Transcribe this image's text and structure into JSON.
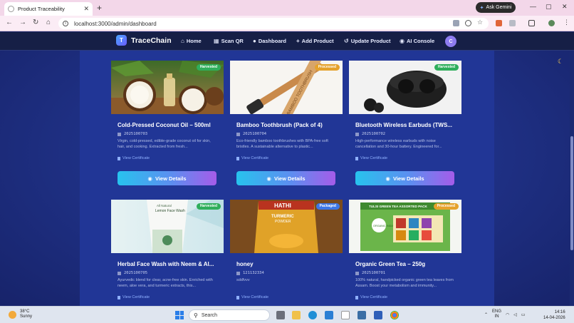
{
  "browser": {
    "tab_title": "Product Traceability",
    "tab_close": "✕",
    "new_tab": "+",
    "url": "localhost:3000/admin/dashboard",
    "ask_gemini": "Ask Gemini",
    "window_controls": [
      "—",
      "▢",
      "✕"
    ],
    "nav_icons": [
      "back-icon",
      "forward-icon",
      "reload-icon",
      "home-icon"
    ]
  },
  "app": {
    "logo_letter": "T",
    "brand": "TraceChain",
    "nav": [
      {
        "label": "Home",
        "icon": "home-icon",
        "glyph": "⌂"
      },
      {
        "label": "Scan QR",
        "icon": "qr-icon",
        "glyph": "▦"
      },
      {
        "label": "Dashboard",
        "icon": "user-icon",
        "glyph": "●"
      },
      {
        "label": "Add Product",
        "icon": "plus-icon",
        "glyph": "+"
      },
      {
        "label": "Update Product",
        "icon": "history-icon",
        "glyph": "↺"
      },
      {
        "label": "AI Console",
        "icon": "robot-icon",
        "glyph": "◉"
      }
    ],
    "avatar_letter": "C"
  },
  "products": [
    {
      "title": "Cold-Pressed Coconut Oil – 500ml",
      "id": "2025100703",
      "status": "Harvested",
      "status_type": "harvested",
      "desc": "Virgin, cold-pressed, edible-grade coconut oil for skin, hair, and cooking. Extracted from fresh...",
      "cert": "View Certificate",
      "button": "View Details"
    },
    {
      "title": "Bamboo Toothbrush (Pack of 4)",
      "id": "2025100704",
      "status": "Processed",
      "status_type": "processed",
      "desc": "Eco-friendly bamboo toothbrushes with BPA-free soft bristles. A sustainable alternative to plastic...",
      "cert": "View Certificate",
      "button": "View Details"
    },
    {
      "title": "Bluetooth Wireless Earbuds (TWS...",
      "id": "2025100702",
      "status": "Harvested",
      "status_type": "harvested",
      "desc": "High-performance wireless earbuds with noise cancellation and 30-hour battery. Engineered for...",
      "cert": "View Certificate",
      "button": "View Details"
    },
    {
      "title": "Herbal Face Wash with Neem & Al...",
      "id": "2025100705",
      "status": "Harvested",
      "status_type": "harvested",
      "desc": "Ayurvedic blend for clear, acne-free skin. Enriched with neem, aloe vera, and turmeric extracts, this...",
      "cert": "View Certificate",
      "button": "View Details"
    },
    {
      "title": "honey",
      "id": "121132334",
      "status": "Packaged",
      "status_type": "packaged",
      "desc": "sddfvvv",
      "cert": "View Certificate",
      "button": "View Details"
    },
    {
      "title": "Organic Green Tea – 250g",
      "id": "2025100701",
      "status": "Processed",
      "status_type": "processed",
      "desc": "100% natural, handpicked organic green tea leaves from Assam. Boost your metabolism and immunity...",
      "cert": "View Certificate",
      "button": "View Details"
    }
  ],
  "product_images": {
    "facewash_text": "All Natural\nLemon Face Wash",
    "hathi_brand": "HATHI",
    "hathi_product": "TURMERIC\nPOWDER",
    "tea_box_title": "TULSI GREEN TEA ASSORTED PACK",
    "tea_brand": "ORGANIC INDIA",
    "brush_text": "BAMBOO TOOTHBRUSH"
  },
  "taskbar": {
    "temp": "38°C",
    "weather": "Sunny",
    "weather_badge": "1",
    "search": "Search",
    "lang": "ENG",
    "region": "IN",
    "time": "14:16",
    "date": "14-04-2026"
  },
  "colors": {
    "accent_gradient_start": "#27c3ee",
    "accent_gradient_end": "#a55ce9",
    "harvested": "#2fae5b",
    "processed": "#e5a22c",
    "packaged": "#3d76e6",
    "background": "#213696"
  }
}
